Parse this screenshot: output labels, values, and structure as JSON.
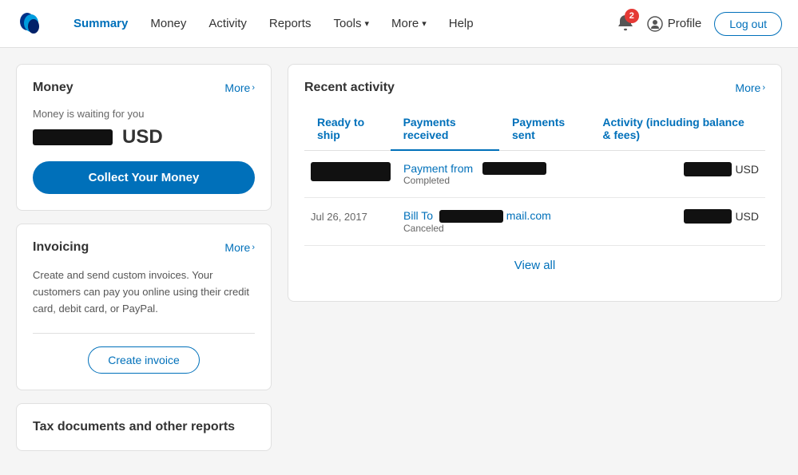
{
  "nav": {
    "logo_alt": "PayPal",
    "links": [
      {
        "id": "summary",
        "label": "Summary",
        "active": true,
        "has_dropdown": false
      },
      {
        "id": "money",
        "label": "Money",
        "active": false,
        "has_dropdown": false
      },
      {
        "id": "activity",
        "label": "Activity",
        "active": false,
        "has_dropdown": false
      },
      {
        "id": "reports",
        "label": "Reports",
        "active": false,
        "has_dropdown": false
      },
      {
        "id": "tools",
        "label": "Tools",
        "active": false,
        "has_dropdown": true
      },
      {
        "id": "more",
        "label": "More",
        "active": false,
        "has_dropdown": true
      },
      {
        "id": "help",
        "label": "Help",
        "active": false,
        "has_dropdown": false
      }
    ],
    "notification_count": "2",
    "profile_label": "Profile",
    "logout_label": "Log out"
  },
  "money_card": {
    "title": "Money",
    "more_label": "More",
    "waiting_text": "Money is waiting for you",
    "currency": "USD",
    "collect_btn": "Collect Your Money"
  },
  "invoicing_card": {
    "title": "Invoicing",
    "more_label": "More",
    "description": "Create and send custom invoices. Your customers can pay you online using their credit card, debit card, or PayPal.",
    "create_btn": "Create invoice"
  },
  "tax_card": {
    "title": "Tax documents and other reports"
  },
  "recent_activity": {
    "title": "Recent activity",
    "more_label": "More",
    "tabs": [
      {
        "id": "ready-to-ship",
        "label": "Ready to ship",
        "active": false
      },
      {
        "id": "payments-received",
        "label": "Payments received",
        "active": true
      },
      {
        "id": "payments-sent",
        "label": "Payments sent",
        "active": false
      },
      {
        "id": "activity-balance",
        "label": "Activity (including balance & fees)",
        "active": false
      }
    ],
    "transactions": [
      {
        "id": "txn1",
        "date": "",
        "description_prefix": "Payment from",
        "email": "",
        "status": "Completed",
        "amount_currency": "USD"
      },
      {
        "id": "txn2",
        "date": "Jul 26, 2017",
        "description_prefix": "Bill To",
        "email": "mail.com",
        "status": "Canceled",
        "amount_currency": "USD"
      }
    ],
    "view_all_label": "View all"
  }
}
